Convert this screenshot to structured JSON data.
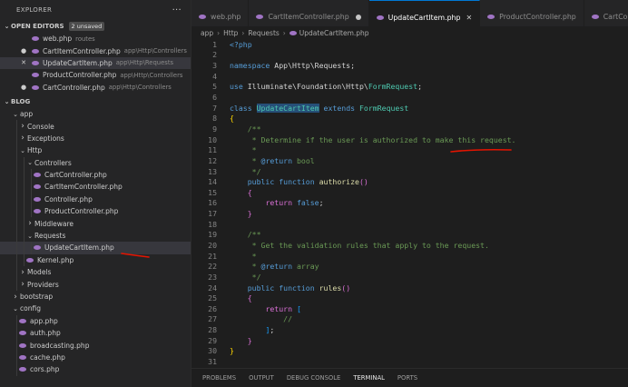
{
  "explorer": {
    "title": "EXPLORER",
    "more": "···",
    "open_editors": {
      "label": "OPEN EDITORS",
      "badge": "2 unsaved",
      "items": [
        {
          "name": "web.php",
          "path": "routes",
          "mark": ""
        },
        {
          "name": "CartItemController.php",
          "path": "app\\Http\\Controllers",
          "mark": "●"
        },
        {
          "name": "UpdateCartItem.php",
          "path": "app\\Http\\Requests",
          "mark": "✕"
        },
        {
          "name": "ProductController.php",
          "path": "app\\Http\\Controllers",
          "mark": ""
        },
        {
          "name": "CartController.php",
          "path": "app\\Http\\Controllers",
          "mark": "●"
        }
      ]
    },
    "project": {
      "label": "BLOG",
      "tree": [
        {
          "label": "app",
          "depth": 0,
          "type": "folder",
          "open": true
        },
        {
          "label": "Console",
          "depth": 1,
          "type": "folder",
          "open": false
        },
        {
          "label": "Exceptions",
          "depth": 1,
          "type": "folder",
          "open": false
        },
        {
          "label": "Http",
          "depth": 1,
          "type": "folder",
          "open": true
        },
        {
          "label": "Controllers",
          "depth": 2,
          "type": "folder",
          "open": true
        },
        {
          "label": "CartController.php",
          "depth": 3,
          "type": "file"
        },
        {
          "label": "CartItemController.php",
          "depth": 3,
          "type": "file"
        },
        {
          "label": "Controller.php",
          "depth": 3,
          "type": "file"
        },
        {
          "label": "ProductController.php",
          "depth": 3,
          "type": "file"
        },
        {
          "label": "Middleware",
          "depth": 2,
          "type": "folder",
          "open": false
        },
        {
          "label": "Requests",
          "depth": 2,
          "type": "folder",
          "open": true
        },
        {
          "label": "UpdateCartItem.php",
          "depth": 3,
          "type": "file",
          "selected": true
        },
        {
          "label": "Kernel.php",
          "depth": 2,
          "type": "file"
        },
        {
          "label": "Models",
          "depth": 1,
          "type": "folder",
          "open": false
        },
        {
          "label": "Providers",
          "depth": 1,
          "type": "folder",
          "open": false
        },
        {
          "label": "bootstrap",
          "depth": 0,
          "type": "folder",
          "open": false
        },
        {
          "label": "config",
          "depth": 0,
          "type": "folder",
          "open": true
        },
        {
          "label": "app.php",
          "depth": 1,
          "type": "file"
        },
        {
          "label": "auth.php",
          "depth": 1,
          "type": "file"
        },
        {
          "label": "broadcasting.php",
          "depth": 1,
          "type": "file"
        },
        {
          "label": "cache.php",
          "depth": 1,
          "type": "file"
        },
        {
          "label": "cors.php",
          "depth": 1,
          "type": "file"
        }
      ]
    }
  },
  "tabs": [
    {
      "label": "web.php",
      "state": ""
    },
    {
      "label": "CartItemController.php",
      "state": "dirty"
    },
    {
      "label": "UpdateCartItem.php",
      "state": "active"
    },
    {
      "label": "ProductController.php",
      "state": ""
    },
    {
      "label": "CartCont",
      "state": ""
    }
  ],
  "breadcrumb": [
    "app",
    "Http",
    "Requests",
    "UpdateCartItem.php"
  ],
  "editor": {
    "lines": [
      {
        "n": "1",
        "tokens": [
          [
            "tag",
            "<?php"
          ]
        ]
      },
      {
        "n": "2",
        "tokens": []
      },
      {
        "n": "3",
        "tokens": [
          [
            "kw",
            "namespace"
          ],
          [
            "",
            " App\\Http\\Requests;"
          ]
        ]
      },
      {
        "n": "4",
        "tokens": []
      },
      {
        "n": "5",
        "tokens": [
          [
            "kw",
            "use"
          ],
          [
            "",
            " Illuminate\\Foundation\\Http\\"
          ],
          [
            "ns",
            "FormRequest"
          ],
          [
            "",
            ";"
          ]
        ]
      },
      {
        "n": "6",
        "tokens": []
      },
      {
        "n": "7",
        "tokens": [
          [
            "kw",
            "class"
          ],
          [
            "",
            " "
          ],
          [
            "nshl",
            "UpdateCartItem"
          ],
          [
            "",
            " "
          ],
          [
            "kw",
            "extends"
          ],
          [
            "",
            " "
          ],
          [
            "ns",
            "FormRequest"
          ]
        ]
      },
      {
        "n": "8",
        "tokens": [
          [
            "br",
            "{"
          ]
        ]
      },
      {
        "n": "9",
        "tokens": [
          [
            "",
            "    "
          ],
          [
            "cm",
            "/**"
          ]
        ]
      },
      {
        "n": "10",
        "tokens": [
          [
            "",
            "     "
          ],
          [
            "cm",
            "* Determine if the user is authorized to make this request."
          ]
        ]
      },
      {
        "n": "11",
        "tokens": [
          [
            "",
            "     "
          ],
          [
            "cm",
            "*"
          ]
        ]
      },
      {
        "n": "12",
        "tokens": [
          [
            "",
            "     "
          ],
          [
            "cm",
            "* "
          ],
          [
            "kw",
            "@return"
          ],
          [
            "cm",
            " bool"
          ]
        ]
      },
      {
        "n": "13",
        "tokens": [
          [
            "",
            "     "
          ],
          [
            "cm",
            "*/"
          ]
        ]
      },
      {
        "n": "14",
        "tokens": [
          [
            "",
            "    "
          ],
          [
            "kw",
            "public"
          ],
          [
            "",
            " "
          ],
          [
            "kw",
            "function"
          ],
          [
            "",
            " "
          ],
          [
            "fn",
            "authorize"
          ],
          [
            "br2",
            "()"
          ]
        ]
      },
      {
        "n": "15",
        "tokens": [
          [
            "",
            "    "
          ],
          [
            "br2",
            "{"
          ]
        ]
      },
      {
        "n": "16",
        "tokens": [
          [
            "",
            "        "
          ],
          [
            "br2kw",
            "return"
          ],
          [
            "",
            " "
          ],
          [
            "kw",
            "false"
          ],
          [
            "",
            ";"
          ]
        ]
      },
      {
        "n": "17",
        "tokens": [
          [
            "",
            "    "
          ],
          [
            "br2",
            "}"
          ]
        ]
      },
      {
        "n": "18",
        "tokens": []
      },
      {
        "n": "19",
        "tokens": [
          [
            "",
            "    "
          ],
          [
            "cm",
            "/**"
          ]
        ]
      },
      {
        "n": "20",
        "tokens": [
          [
            "",
            "     "
          ],
          [
            "cm",
            "* Get the validation rules that apply to the request."
          ]
        ]
      },
      {
        "n": "21",
        "tokens": [
          [
            "",
            "     "
          ],
          [
            "cm",
            "*"
          ]
        ]
      },
      {
        "n": "22",
        "tokens": [
          [
            "",
            "     "
          ],
          [
            "cm",
            "* "
          ],
          [
            "kw",
            "@return"
          ],
          [
            "cm",
            " array"
          ]
        ]
      },
      {
        "n": "23",
        "tokens": [
          [
            "",
            "     "
          ],
          [
            "cm",
            "*/"
          ]
        ]
      },
      {
        "n": "24",
        "tokens": [
          [
            "",
            "    "
          ],
          [
            "kw",
            "public"
          ],
          [
            "",
            " "
          ],
          [
            "kw",
            "function"
          ],
          [
            "",
            " "
          ],
          [
            "fn",
            "rules"
          ],
          [
            "br2",
            "()"
          ]
        ]
      },
      {
        "n": "25",
        "tokens": [
          [
            "",
            "    "
          ],
          [
            "br2",
            "{"
          ]
        ]
      },
      {
        "n": "26",
        "tokens": [
          [
            "",
            "        "
          ],
          [
            "br2kw",
            "return"
          ],
          [
            "",
            " "
          ],
          [
            "br3",
            "["
          ]
        ]
      },
      {
        "n": "27",
        "tokens": [
          [
            "",
            "            "
          ],
          [
            "cm",
            "//"
          ]
        ]
      },
      {
        "n": "28",
        "tokens": [
          [
            "",
            "        "
          ],
          [
            "br3",
            "]"
          ],
          [
            "",
            ";"
          ]
        ]
      },
      {
        "n": "29",
        "tokens": [
          [
            "",
            "    "
          ],
          [
            "br2",
            "}"
          ]
        ]
      },
      {
        "n": "30",
        "tokens": [
          [
            "br",
            "}"
          ]
        ]
      },
      {
        "n": "31",
        "tokens": []
      }
    ]
  },
  "panel": {
    "tabs": [
      "PROBLEMS",
      "OUTPUT",
      "DEBUG CONSOLE",
      "TERMINAL",
      "PORTS"
    ],
    "active": "TERMINAL"
  },
  "colors": {
    "accent": "#0078d4",
    "annotation": "#e51400",
    "php_icon": "#a074c4"
  }
}
